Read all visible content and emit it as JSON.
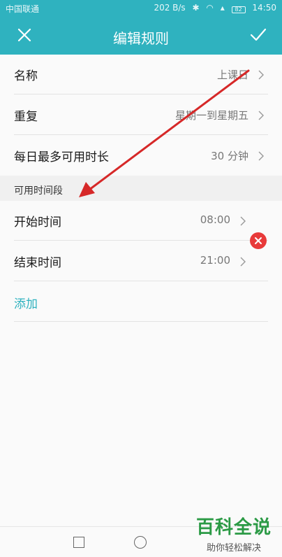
{
  "status_bar": {
    "carrier": "中国联通",
    "speed": "202 B/s",
    "battery": "82",
    "time": "14:50"
  },
  "header": {
    "title": "编辑规则",
    "close_icon": "close-icon",
    "confirm_icon": "check-icon"
  },
  "rules": [
    {
      "label": "名称",
      "value": "上课日"
    },
    {
      "label": "重复",
      "value": "星期一到星期五"
    },
    {
      "label": "每日最多可用时长",
      "value": "30 分钟"
    }
  ],
  "section": {
    "title": "可用时间段"
  },
  "time_slots": [
    {
      "label": "开始时间",
      "value": "08:00"
    },
    {
      "label": "结束时间",
      "value": "21:00"
    }
  ],
  "add_label": "添加",
  "watermark": {
    "main": "百科全说",
    "sub": "助你轻松解决"
  },
  "colors": {
    "accent": "#2fb2bf",
    "delete": "#e83a3a",
    "annotation_arrow": "#d62828"
  }
}
